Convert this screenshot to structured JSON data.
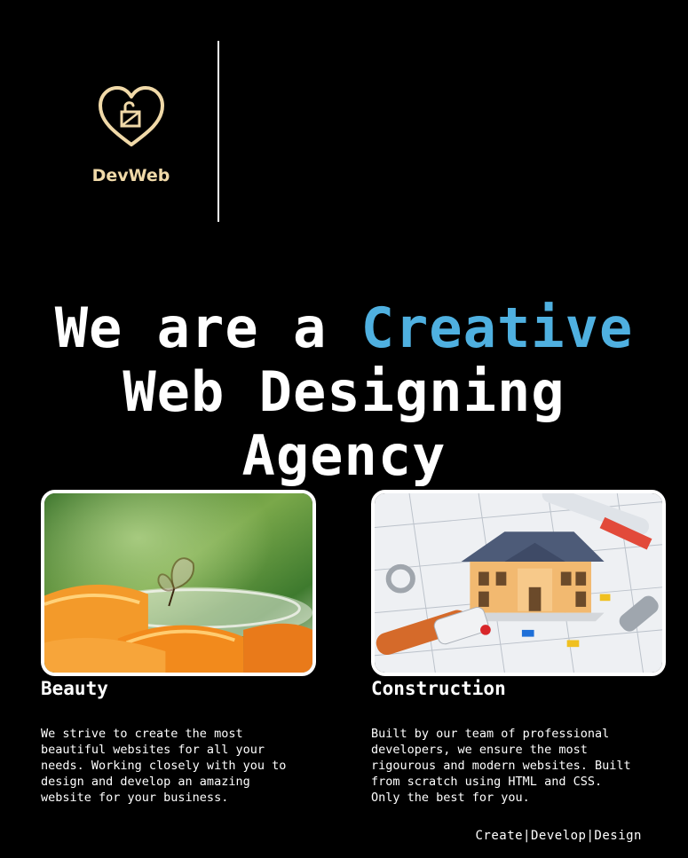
{
  "brand": {
    "name": "DevWeb",
    "icon": "heart-lock-icon",
    "color": "#f0d9a8"
  },
  "hero": {
    "line1_pre": "We are a ",
    "line1_accent": "Creative",
    "line2": "Web Designing",
    "line3": "Agency",
    "accent_color": "#4fb0e0"
  },
  "cards": [
    {
      "image": "butterfly-orange-photo",
      "title": "Beauty",
      "text": "We strive to create the most beautiful websites for all your needs. Working closely with you to design and develop an amazing website for your business."
    },
    {
      "image": "house-blueprint-photo",
      "title": "Construction",
      "text": "Built by our team of professional developers, we ensure the most rigourous and modern websites. Built from scratch using HTML and CSS. Only the best for you."
    }
  ],
  "footer": {
    "text": "Create|Develop|Design"
  }
}
